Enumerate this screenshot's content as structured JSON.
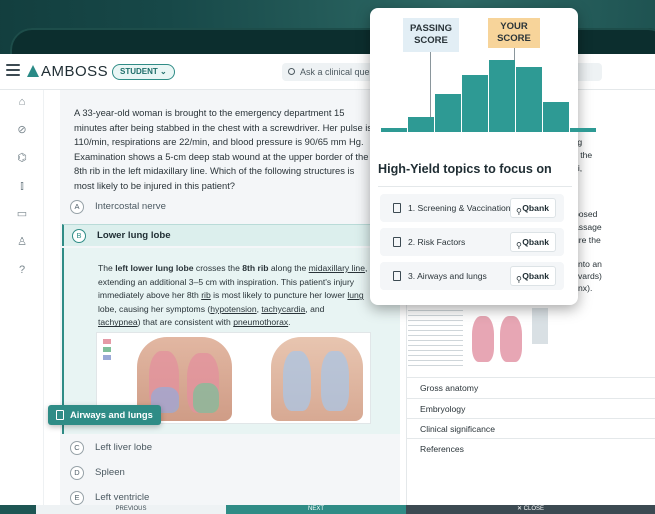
{
  "app": {
    "logo_text": "AMBOSS",
    "student_badge": "STUDENT ⌄"
  },
  "search": {
    "placeholder": "Ask a clinical quest"
  },
  "sidebar": {
    "icons": [
      "home-icon",
      "pill-icon",
      "graduation-cap-icon",
      "bar-chart-icon",
      "book-icon",
      "user-icon",
      "help-icon"
    ]
  },
  "question": {
    "stem": "A 33-year-old woman is brought to the emergency department 15 minutes after being stabbed in the chest with a screwdriver. Her pulse is 110/min, respirations are 22/min, and blood pressure is 90/65 mm Hg. Examination shows a 5-cm deep stab wound at the upper border of the 8th rib in the left midaxillary line. Which of the following structures is most likely to be injured in this patient?",
    "options": [
      {
        "letter": "A",
        "text": "Intercostal nerve"
      },
      {
        "letter": "B",
        "text": "Lower lung lobe"
      },
      {
        "letter": "C",
        "text": "Left liver lobe"
      },
      {
        "letter": "D",
        "text": "Spleen"
      },
      {
        "letter": "E",
        "text": "Left ventricle"
      }
    ],
    "explanation": {
      "p1": "The ",
      "b1": "left lower lung lobe",
      "p2": " crosses the ",
      "b2": "8th rib",
      "p3": " along the ",
      "u1": "midaxillary line",
      "p4": ", extending an additional 3–5 cm with inspiration. This patient's injury immediately above her 8th ",
      "u2": "rib",
      "p5": " is most likely to puncture her lower ",
      "u3": "lung",
      "p6": " lobe, causing her symptoms (",
      "u4": "hypotension",
      "p7": ", ",
      "u5": "tachycardia",
      "p8": ", and ",
      "u6": "tachypnea",
      "p9": ") that are consistent with ",
      "u7": "pneumothorax",
      "p10": "."
    }
  },
  "tag": {
    "label": "Airways and lungs"
  },
  "bottom": {
    "prev": "PREVIOUS",
    "next": "NEXT",
    "close": "✕ CLOSE"
  },
  "right_panel": {
    "lines": [
      "cting",
      "s of the",
      "achi,",
      "posed",
      "assage",
      "ure the",
      "nto an",
      "vards)",
      "nx)."
    ],
    "sections": [
      "Gross anatomy",
      "Embryology",
      "Clinical significance",
      "References"
    ]
  },
  "score_card": {
    "passing_label_line1": "PASSING",
    "passing_label_line2": "SCORE",
    "your_label_line1": "YOUR",
    "your_label_line2": "SCORE",
    "title": "High-Yield topics to focus on",
    "topics": [
      {
        "label": "1. Screening & Vaccination",
        "action": "Qbank"
      },
      {
        "label": "2. Risk Factors",
        "action": "Qbank"
      },
      {
        "label": "3. Airways and lungs",
        "action": "Qbank"
      }
    ],
    "histogram": [
      0.05,
      0.2,
      0.5,
      0.75,
      0.95,
      0.85,
      0.4,
      0.05
    ],
    "bar_color": "#2e9a94"
  },
  "colors": {
    "accent": "#2f8c86",
    "highlight": "#f7d49a",
    "passing": "#e2eef5"
  }
}
